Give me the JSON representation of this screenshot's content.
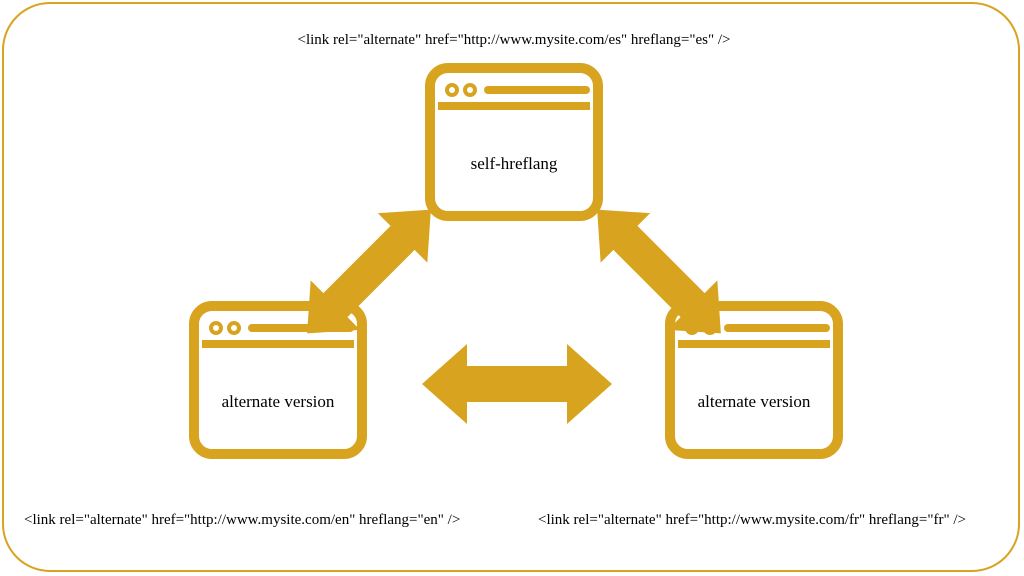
{
  "colors": {
    "accent": "#d8a41f"
  },
  "captions": {
    "top": "<link rel=\"alternate\" href=\"http://www.mysite.com/es\" hreflang=\"es\" />",
    "left": "<link rel=\"alternate\" href=\"http://www.mysite.com/en\" hreflang=\"en\" />",
    "right": "<link rel=\"alternate\" href=\"http://www.mysite.com/fr\" hreflang=\"fr\" />"
  },
  "windows": {
    "top": {
      "label": "self-hreflang"
    },
    "left": {
      "label": "alternate version"
    },
    "right": {
      "label": "alternate version"
    }
  }
}
